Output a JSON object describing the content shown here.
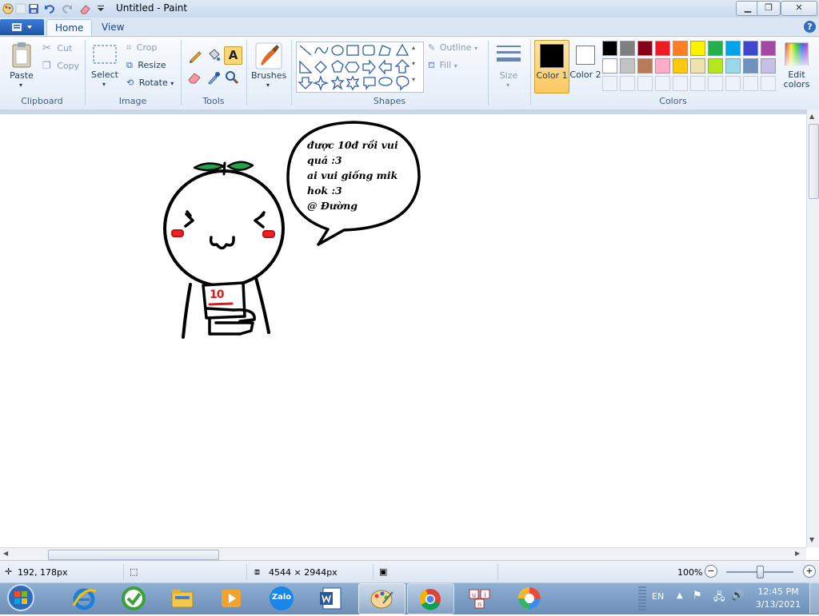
{
  "window": {
    "title": "Untitled - Paint"
  },
  "tabs": [
    {
      "label": "Home"
    },
    {
      "label": "View"
    }
  ],
  "clipboard": {
    "paste": "Paste",
    "cut": "Cut",
    "copy": "Copy",
    "group": "Clipboard"
  },
  "image": {
    "select": "Select",
    "crop": "Crop",
    "resize": "Resize",
    "rotate": "Rotate",
    "group": "Image"
  },
  "tools": {
    "group": "Tools"
  },
  "brushes": {
    "label": "Brushes"
  },
  "shapes": {
    "outline": "Outline",
    "fill": "Fill",
    "group": "Shapes"
  },
  "size": {
    "label": "Size"
  },
  "colors": {
    "color1": "Color 1",
    "color2": "Color 2",
    "edit": "Edit colors",
    "group": "Colors",
    "color1_value": "#000000",
    "color2_value": "#ffffff",
    "palette_row1": [
      "#000000",
      "#7f7f7f",
      "#880015",
      "#ed1c24",
      "#ff7f27",
      "#fff200",
      "#22b14c",
      "#00a2e8",
      "#3f48cc",
      "#a349a4"
    ],
    "palette_row2": [
      "#ffffff",
      "#c3c3c3",
      "#b97a57",
      "#ffaec9",
      "#ffc90e",
      "#efe4b0",
      "#b5e61d",
      "#99d9ea",
      "#7092be",
      "#c8bfe7"
    ]
  },
  "drawing": {
    "bubble_lines": [
      "được 10đ rồi vui",
      "quá :3",
      "ai vui giống mik",
      "hok :3",
      "@ Đường"
    ],
    "paper_text": "10"
  },
  "status": {
    "cursor": "192, 178px",
    "size": "4544 × 2944px",
    "zoom": "100%"
  },
  "taskbar": {
    "apps": [
      "start-orb",
      "internet-explorer",
      "app-green",
      "file-explorer",
      "media-player",
      "zalo",
      "word",
      "paint",
      "chrome",
      "app-uni",
      "app-color"
    ],
    "zalo_label": "Zalo",
    "lang": "EN",
    "time": "12:45 PM",
    "date": "3/13/2021"
  }
}
